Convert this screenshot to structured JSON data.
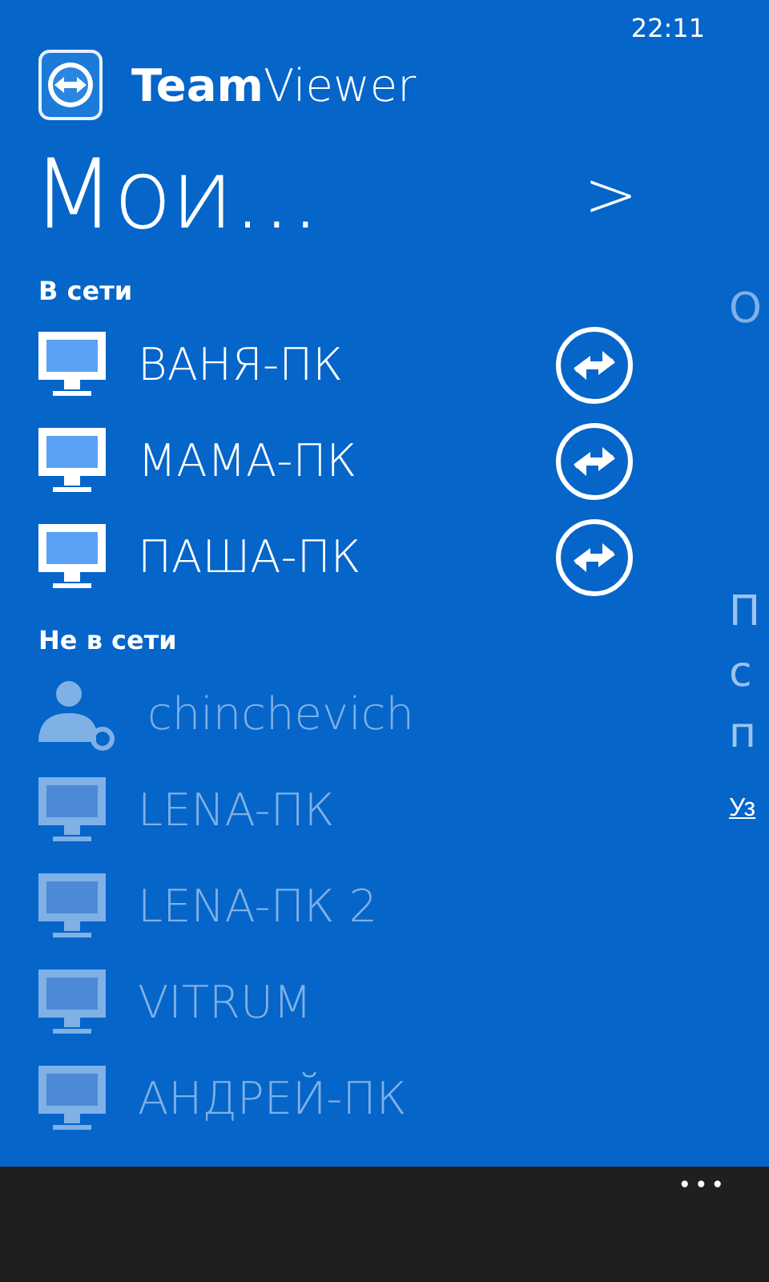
{
  "status_bar": {
    "time": "22:11"
  },
  "app": {
    "name_bold": "Team",
    "name_light": "Viewer"
  },
  "pivot": {
    "title": "Мои...",
    "next_arrow": ">",
    "peek_subtitle": "О",
    "peek_lines": [
      "П",
      "с",
      "п"
    ],
    "peek_link": "Уз"
  },
  "groups": [
    {
      "header": "В сети",
      "items": [
        {
          "name": "ВАНЯ-ПК",
          "kind": "computer",
          "online": true
        },
        {
          "name": "МАМА-ПК",
          "kind": "computer",
          "online": true
        },
        {
          "name": "ПАША-ПК",
          "kind": "computer",
          "online": true
        }
      ]
    },
    {
      "header": "Не в сети",
      "items": [
        {
          "name": "chinchevich",
          "kind": "user",
          "online": false
        },
        {
          "name": "LENA-ПК",
          "kind": "computer",
          "online": false
        },
        {
          "name": "LENA-ПК 2",
          "kind": "computer",
          "online": false
        },
        {
          "name": "VITRUM",
          "kind": "computer",
          "online": false
        },
        {
          "name": "АНДРЕЙ-ПК",
          "kind": "computer",
          "online": false
        }
      ]
    }
  ],
  "app_bar": {
    "more": "•••"
  }
}
